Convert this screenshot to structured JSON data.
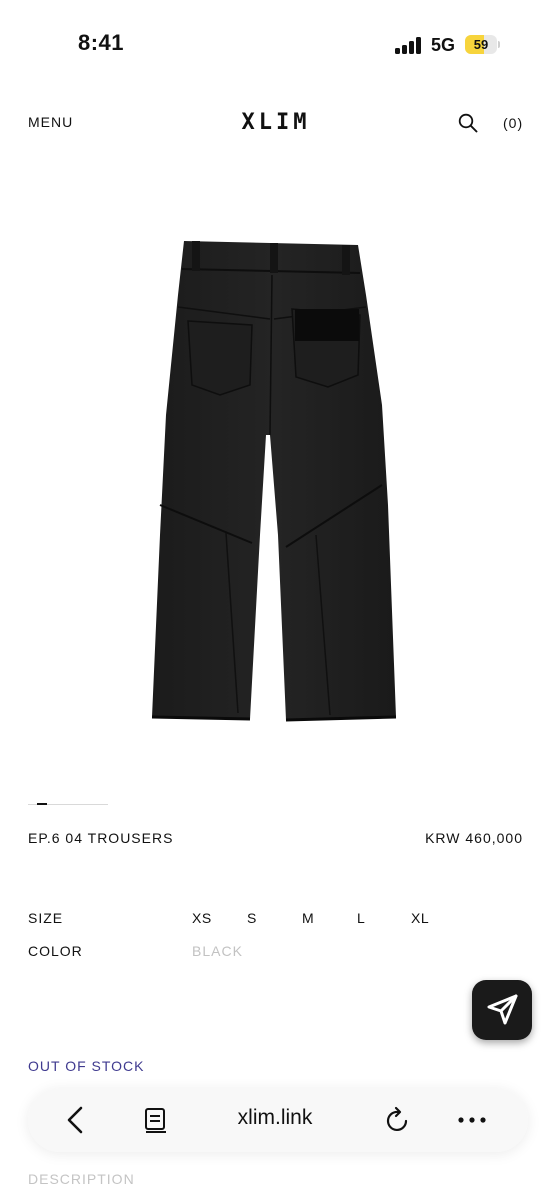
{
  "status_bar": {
    "time": "8:41",
    "network": "5G",
    "battery": "59",
    "battery_level": 0.59
  },
  "header": {
    "menu_label": "MENU",
    "logo": "XLIM",
    "cart_label": "(0)",
    "icons": [
      "search-icon"
    ]
  },
  "product": {
    "image_alt": "black trousers back view",
    "name": "EP.6 04 TROUSERS",
    "price": "KRW 460,000",
    "size_label": "SIZE",
    "sizes": [
      "XS",
      "S",
      "M",
      "L",
      "XL"
    ],
    "color_label": "COLOR",
    "color_value": "BLACK",
    "stock_status": "OUT OF STOCK",
    "description_label": "DESCRIPTION",
    "gallery_position": 1
  },
  "fab": {
    "icon": "send-icon"
  },
  "browser_toolbar": {
    "url": "xlim.link",
    "icons": [
      "back-icon",
      "reader-icon",
      "reload-icon",
      "more-icon"
    ]
  },
  "colors": {
    "accent": "#3f3a8f",
    "muted": "#c2c2c2",
    "fab": "#1a1a1a",
    "battery": "#f7d43c"
  }
}
